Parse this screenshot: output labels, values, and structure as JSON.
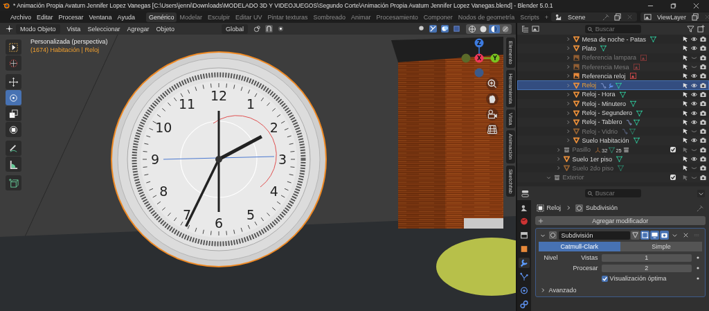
{
  "window": {
    "title": "* Animación Propia Avaturn Jennifer Lopez Vanegas [C:\\Users\\jenni\\Downloads\\MODELADO 3D Y VIDEOJUEGOS\\Segundo Corte\\Animación Propia Avaturn Jennifer Lopez Vanegas.blend] - Blender 5.0.1"
  },
  "menu": [
    "Archivo",
    "Editar",
    "Procesar",
    "Ventana",
    "Ayuda"
  ],
  "workspaces": [
    {
      "label": "Genérico",
      "selected": true
    },
    {
      "label": "Modelar",
      "selected": false
    },
    {
      "label": "Esculpir",
      "selected": false
    },
    {
      "label": "Editar UV",
      "selected": false
    },
    {
      "label": "Pintar texturas",
      "selected": false
    },
    {
      "label": "Sombreado",
      "selected": false
    },
    {
      "label": "Animar",
      "selected": false
    },
    {
      "label": "Procesamiento",
      "selected": false
    },
    {
      "label": "Componer",
      "selected": false
    },
    {
      "label": "Nodos de geometría",
      "selected": false
    },
    {
      "label": "Scripts",
      "selected": false
    }
  ],
  "add_workspace": "+",
  "scene": {
    "value": "Scene"
  },
  "view_layer": {
    "value": "ViewLayer"
  },
  "viewport": {
    "header": {
      "mode": "Modo Objeto",
      "menus": [
        "Vista",
        "Seleccionar",
        "Agregar",
        "Objeto"
      ],
      "orientation": "Global",
      "shading": [
        {
          "kind": "wireframe",
          "selected": false
        },
        {
          "kind": "solid",
          "selected": false
        },
        {
          "kind": "material",
          "selected": true
        },
        {
          "kind": "rendered",
          "selected": false
        }
      ]
    },
    "tools": [
      {
        "kind": "select",
        "selected": false
      },
      {
        "kind": "cursor",
        "selected": false
      },
      {
        "kind": "move",
        "selected": false
      },
      {
        "kind": "rotate",
        "selected": true
      },
      {
        "kind": "scale",
        "selected": false
      },
      {
        "kind": "transform",
        "selected": false
      },
      {
        "kind": "annotate",
        "selected": false
      },
      {
        "kind": "measure",
        "selected": false
      },
      {
        "kind": "add-cube",
        "selected": false
      }
    ],
    "view_name": "Personalizada (perspectiva)",
    "context": "(1674) Habitación | Reloj",
    "clock": {
      "numerals": [
        "12",
        "1",
        "2",
        "3",
        "4",
        "5",
        "6",
        "7",
        "8",
        "9",
        "10",
        "11"
      ]
    },
    "gizmo": {
      "z": "Z",
      "x": "X",
      "y": "Y"
    },
    "sidebar_tabs": [
      "Elemento",
      "Herramienta",
      "Vista",
      "Animación",
      "Sketchfab"
    ]
  },
  "outliner": {
    "search": {
      "placeholder": "Buscar"
    },
    "tree": [
      {
        "children": [
          {
            "children": [
              {
                "name": "Mesa de noche - Patas",
                "kind": "object",
                "dimmed": false,
                "selected": false,
                "visible": true,
                "expanded": false,
                "extras": [
                  {
                    "kind": "mesh"
                  }
                ]
              },
              {
                "name": "Plato",
                "kind": "object",
                "dimmed": false,
                "selected": false,
                "visible": true,
                "expanded": false,
                "extras": [
                  {
                    "kind": "mesh"
                  }
                ]
              },
              {
                "name": "Referencia lampara",
                "kind": "image",
                "dimmed": true,
                "selected": false,
                "visible": false,
                "expanded": false,
                "extras": [
                  {
                    "kind": "image"
                  }
                ]
              },
              {
                "name": "Referencia Mesa",
                "kind": "image",
                "dimmed": true,
                "selected": false,
                "visible": false,
                "expanded": false,
                "extras": [
                  {
                    "kind": "image"
                  }
                ]
              },
              {
                "name": "Referencia reloj",
                "kind": "image",
                "dimmed": false,
                "selected": false,
                "visible": true,
                "expanded": false,
                "extras": [
                  {
                    "kind": "image"
                  }
                ]
              },
              {
                "name": "Reloj",
                "kind": "object",
                "dimmed": false,
                "selected": true,
                "visible": true,
                "expanded": false,
                "extras": [
                  {
                    "kind": "constraint"
                  },
                  {
                    "kind": "modifier"
                  },
                  {
                    "kind": "mesh"
                  }
                ]
              },
              {
                "name": "Reloj - Hora",
                "kind": "object",
                "dimmed": false,
                "selected": false,
                "visible": true,
                "expanded": false,
                "extras": [
                  {
                    "kind": "mesh"
                  }
                ]
              },
              {
                "name": "Reloj - Minutero",
                "kind": "object",
                "dimmed": false,
                "selected": false,
                "visible": true,
                "expanded": false,
                "extras": [
                  {
                    "kind": "mesh"
                  }
                ]
              },
              {
                "name": "Reloj - Segundero",
                "kind": "object",
                "dimmed": false,
                "selected": false,
                "visible": true,
                "expanded": false,
                "extras": [
                  {
                    "kind": "mesh"
                  }
                ]
              },
              {
                "name": "Reloj - Tablero",
                "kind": "object",
                "dimmed": false,
                "selected": false,
                "visible": true,
                "expanded": false,
                "extras": [
                  {
                    "kind": "constraint"
                  },
                  {
                    "kind": "mesh"
                  }
                ]
              },
              {
                "name": "Reloj - Vidrio",
                "kind": "object",
                "dimmed": true,
                "selected": false,
                "visible": false,
                "expanded": false,
                "extras": [
                  {
                    "kind": "constraint"
                  },
                  {
                    "kind": "mesh"
                  }
                ]
              },
              {
                "name": "Suelo Habitación",
                "kind": "object",
                "dimmed": false,
                "selected": false,
                "visible": true,
                "expanded": false,
                "extras": [
                  {
                    "kind": "mesh"
                  }
                ]
              }
            ]
          },
          {
            "name": "Pasillo",
            "kind": "collection",
            "dimmed": true,
            "selected": false,
            "visible": false,
            "expanded": false,
            "checked": true,
            "extras": [
              {
                "kind": "armature",
                "count": "32"
              },
              {
                "kind": "mesh",
                "count": "25"
              },
              {
                "kind": "collection"
              }
            ]
          },
          {
            "name": "Suelo 1er piso",
            "kind": "object",
            "dimmed": false,
            "selected": false,
            "visible": true,
            "expanded": false,
            "extras": [
              {
                "kind": "mesh"
              }
            ]
          },
          {
            "name": "Suelo 2do piso",
            "kind": "object",
            "dimmed": true,
            "selected": false,
            "visible": false,
            "expanded": false,
            "extras": [
              {
                "kind": "mesh"
              }
            ]
          }
        ]
      },
      {
        "name": "Exterior",
        "kind": "collection",
        "dimmed": true,
        "selected": false,
        "visible": false,
        "expanded": true,
        "checked": true
      }
    ]
  },
  "properties": {
    "search": {
      "placeholder": "Buscar"
    },
    "tabs": [
      {
        "kind": "scene",
        "selected": false
      },
      {
        "kind": "world",
        "selected": false
      },
      {
        "kind": "collection",
        "selected": false
      },
      {
        "kind": "object",
        "selected": false
      },
      {
        "kind": "modifier",
        "selected": true
      },
      {
        "kind": "particles",
        "selected": false
      },
      {
        "kind": "physics",
        "selected": false
      },
      {
        "kind": "constraints",
        "selected": false
      }
    ],
    "breadcrumb": {
      "object": "Reloj",
      "modifier": "Subdivisión"
    },
    "add_button": "Agregar modificador",
    "modifier": {
      "name": "Subdivisión",
      "expanded": true,
      "toggles": [
        {
          "kind": "on-cage",
          "on": false
        },
        {
          "kind": "edit-mode",
          "on": true
        },
        {
          "kind": "viewport",
          "on": true
        },
        {
          "kind": "render",
          "on": true
        }
      ],
      "algorithms": [
        {
          "label": "Catmull-Clark",
          "selected": true
        },
        {
          "label": "Simple",
          "selected": false
        }
      ],
      "levels_label": "Nivel",
      "fields": [
        {
          "label": "Vistas",
          "value": "1"
        },
        {
          "label": "Procesar",
          "value": "2"
        }
      ],
      "optimal": {
        "label": "Visualización óptima",
        "checked": true
      },
      "advanced": {
        "label": "Avanzado",
        "expanded": false
      }
    }
  }
}
